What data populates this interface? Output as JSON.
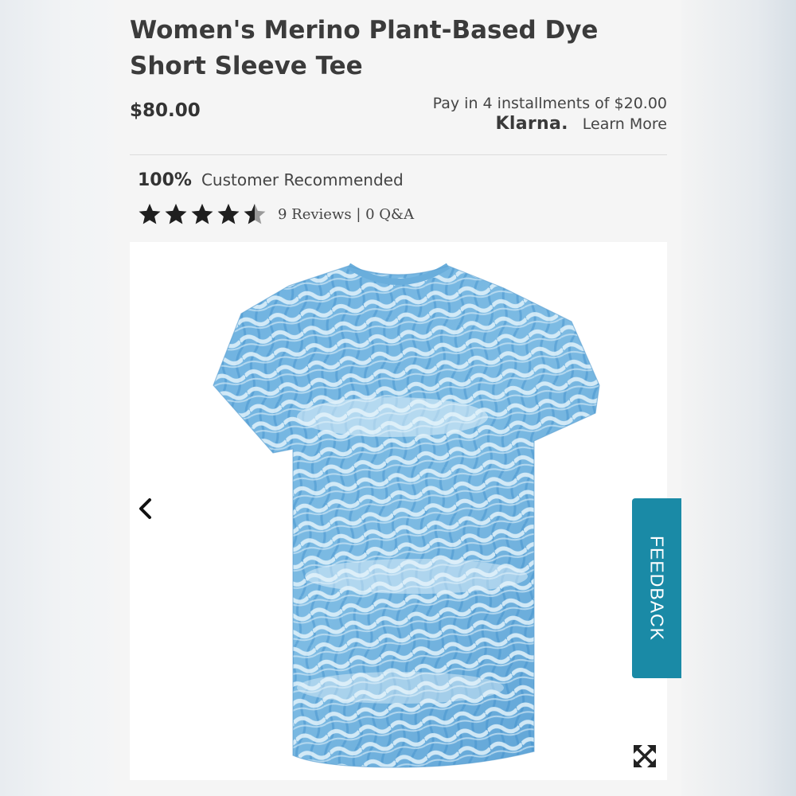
{
  "product": {
    "title": "Women's Merino Plant-Based Dye Short Sleeve Tee",
    "price": "$80.00"
  },
  "klarna": {
    "installments_text": "Pay in 4 installments of $20.00",
    "logo_text": "Klarna.",
    "learn_more_label": "Learn More"
  },
  "recommendation": {
    "percent": "100%",
    "label": "Customer Recommended"
  },
  "rating": {
    "stars_value": 4.5,
    "stars_max": 5,
    "reviews_text": "9 Reviews | 0 Q&A"
  },
  "gallery": {
    "prev_icon": "chevron-left-icon",
    "expand_icon": "expand-arrows-icon",
    "image_subject": "blue and white tie-dye short sleeve t-shirt"
  },
  "feedback": {
    "label": "FEEDBACK",
    "color": "#1a8aa6"
  },
  "colors": {
    "star": "#1f1f1f",
    "tee_blue": "#5ea6d8",
    "tee_light": "#d6ecf7"
  }
}
